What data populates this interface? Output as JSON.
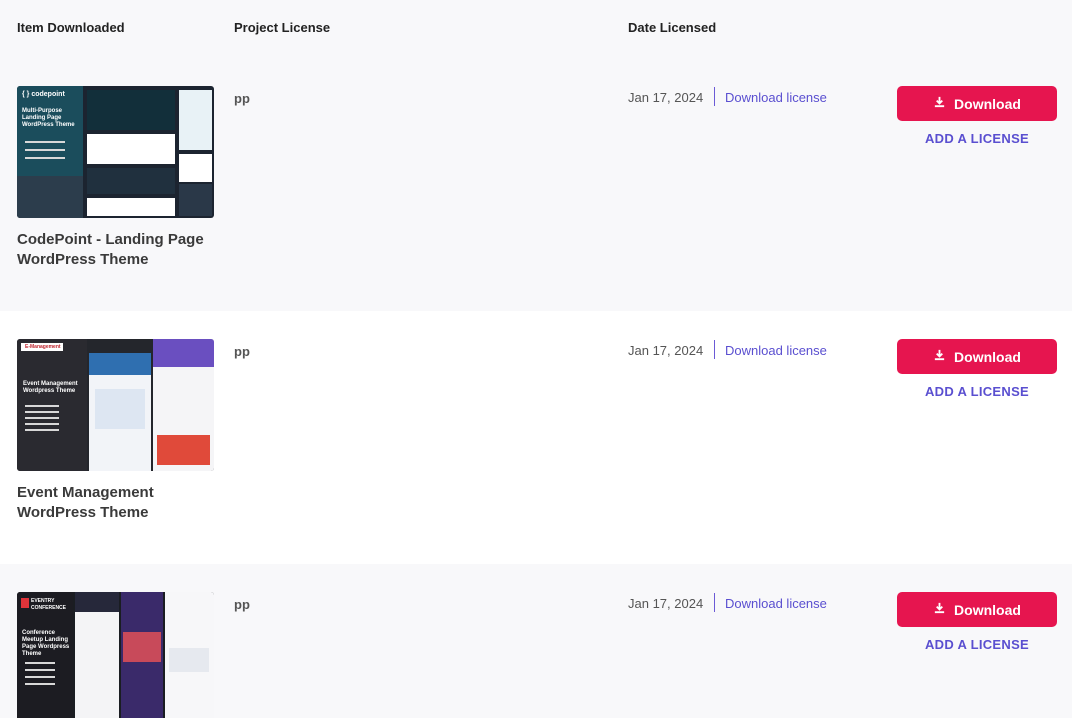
{
  "table": {
    "headers": {
      "item": "Item Downloaded",
      "project": "Project License",
      "date": "Date Licensed"
    }
  },
  "items": [
    {
      "title": "CodePoint - Landing Page WordPress Theme",
      "project": "pp",
      "date": "Jan 17, 2024",
      "license_link": "Download license",
      "download_label": "Download",
      "add_license_label": "ADD A LICENSE",
      "thumb": {
        "brand": "{ } codepoint",
        "headline": "Multi-Purpose Landing Page WordPress Theme"
      }
    },
    {
      "title": "Event Management WordPress Theme",
      "project": "pp",
      "date": "Jan 17, 2024",
      "license_link": "Download license",
      "download_label": "Download",
      "add_license_label": "ADD A LICENSE",
      "thumb": {
        "brand": "E-Management",
        "headline": "Event Management Wordpress Theme"
      }
    },
    {
      "title": "",
      "project": "pp",
      "date": "Jan 17, 2024",
      "license_link": "Download license",
      "download_label": "Download",
      "add_license_label": "ADD A LICENSE",
      "thumb": {
        "brand": "EVENTRY CONFERENCE",
        "headline": "Conference Meetup Landing Page Wordpress Theme"
      }
    }
  ],
  "colors": {
    "accent": "#e6154f",
    "link": "#5a4fd0"
  }
}
